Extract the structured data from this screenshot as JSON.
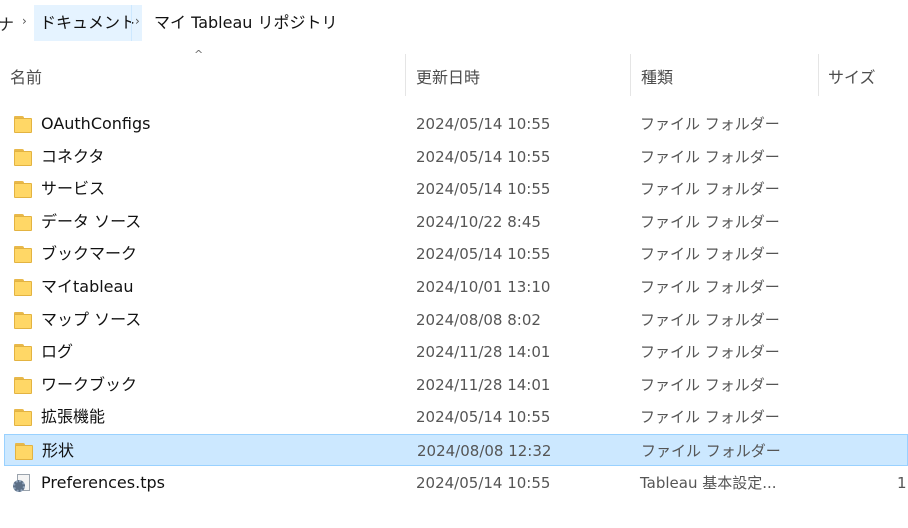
{
  "breadcrumb": {
    "partial": "ナ",
    "items": [
      "ドキュメント",
      "マイ Tableau リポジトリ"
    ]
  },
  "columns": {
    "name": "名前",
    "modified": "更新日時",
    "type": "種類",
    "size": "サイズ",
    "sort_indicator": "^"
  },
  "rows": [
    {
      "name": "OAuthConfigs",
      "date": "2024/05/14 10:55",
      "type": "ファイル フォルダー",
      "size": "",
      "icon": "folder-icon"
    },
    {
      "name": "コネクタ",
      "date": "2024/05/14 10:55",
      "type": "ファイル フォルダー",
      "size": "",
      "icon": "folder-icon"
    },
    {
      "name": "サービス",
      "date": "2024/05/14 10:55",
      "type": "ファイル フォルダー",
      "size": "",
      "icon": "folder-icon"
    },
    {
      "name": "データ ソース",
      "date": "2024/10/22 8:45",
      "type": "ファイル フォルダー",
      "size": "",
      "icon": "folder-icon"
    },
    {
      "name": "ブックマーク",
      "date": "2024/05/14 10:55",
      "type": "ファイル フォルダー",
      "size": "",
      "icon": "folder-icon"
    },
    {
      "name": "マイtableau",
      "date": "2024/10/01 13:10",
      "type": "ファイル フォルダー",
      "size": "",
      "icon": "folder-icon"
    },
    {
      "name": "マップ ソース",
      "date": "2024/08/08 8:02",
      "type": "ファイル フォルダー",
      "size": "",
      "icon": "folder-icon"
    },
    {
      "name": "ログ",
      "date": "2024/11/28 14:01",
      "type": "ファイル フォルダー",
      "size": "",
      "icon": "folder-icon"
    },
    {
      "name": "ワークブック",
      "date": "2024/11/28 14:01",
      "type": "ファイル フォルダー",
      "size": "",
      "icon": "folder-icon"
    },
    {
      "name": "拡張機能",
      "date": "2024/05/14 10:55",
      "type": "ファイル フォルダー",
      "size": "",
      "icon": "folder-icon"
    },
    {
      "name": "形状",
      "date": "2024/08/08 12:32",
      "type": "ファイル フォルダー",
      "size": "",
      "icon": "folder-icon",
      "selected": true
    },
    {
      "name": "Preferences.tps",
      "date": "2024/05/14 10:55",
      "type": "Tableau 基本設定...",
      "size": "1",
      "icon": "settings-file-icon"
    }
  ],
  "colors": {
    "selection_bg": "#cce8ff",
    "selection_border": "#99d1ff",
    "folder": "#ffd766",
    "breadcrumb_hover": "#e5f3ff"
  }
}
